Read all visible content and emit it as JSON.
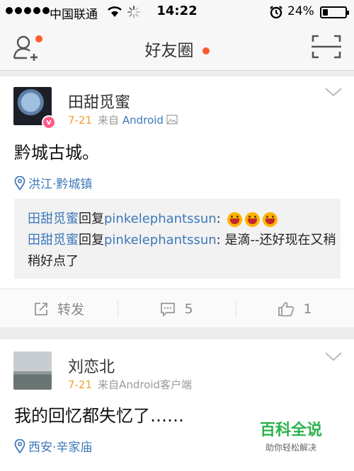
{
  "status_bar": {
    "carrier": "中国联通",
    "time": "14:22",
    "battery": "24%",
    "battery_level": 0.24
  },
  "nav": {
    "title": "好友圈"
  },
  "posts": [
    {
      "username": "田甜觅蜜",
      "date": "7-21",
      "source_prefix": "来自",
      "client": "Android",
      "text": "黔城古城。",
      "location": "洪江·黔城镇",
      "comments": [
        {
          "author": "田甜觅蜜",
          "verb": "回复",
          "target": "pinkelephantssun",
          "sep": ": ",
          "body": "",
          "emojis": 3
        },
        {
          "author": "田甜觅蜜",
          "verb": "回复",
          "target": "pinkelephantssun",
          "sep": ": ",
          "body": "是滴--还好现在又稍稍好点了",
          "emojis": 0
        }
      ],
      "actions": {
        "repost": "转发",
        "comment_count": "5",
        "like_count": "1"
      }
    },
    {
      "username": "刘恋北",
      "date": "7-21",
      "source_prefix": "来自",
      "client": "Android客户端",
      "text": "我的回忆都失忆了……",
      "location": "西安·辛家庙"
    }
  ],
  "watermark": {
    "title": "百科全说",
    "subtitle": "助你轻松解决"
  }
}
